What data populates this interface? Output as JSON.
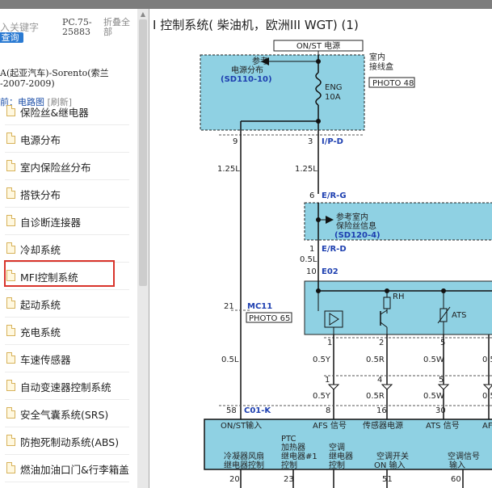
{
  "sidebar": {
    "search_hint": "入关键字",
    "search_button": "查询",
    "pc_code_line1": "PC.75-",
    "pc_code_line2": "25883",
    "collapse_line1": "折叠全",
    "collapse_line2": "部",
    "vehicle_line1": "A(起亚汽车)-Sorento(索兰",
    "vehicle_line2": "-2007-2009)",
    "crumb_current": "前：电路图",
    "crumb_refresh": "[刷新]",
    "items": [
      {
        "label": "保险丝&继电器"
      },
      {
        "label": "电源分布"
      },
      {
        "label": "室内保险丝分布"
      },
      {
        "label": "搭铁分布"
      },
      {
        "label": "自诊断连接器"
      },
      {
        "label": "冷却系统"
      },
      {
        "label": "MFI控制系统",
        "selected": true
      },
      {
        "label": "起动系统"
      },
      {
        "label": "充电系统"
      },
      {
        "label": "车速传感器"
      },
      {
        "label": "自动变速器控制系统"
      },
      {
        "label": "安全气囊系统(SRS)"
      },
      {
        "label": "防抱死制动系统(ABS)"
      },
      {
        "label": "燃油加油口门&行李箱盖"
      }
    ]
  },
  "diagram": {
    "title": "I 控制系统( 柴油机，欧洲III WGT) (1)",
    "on_st_power": "ON/ST 电源",
    "junction_box_line1": "室内",
    "junction_box_line2": "接线盒",
    "photo_48": "PHOTO 48",
    "ref_power_line1": "参考",
    "ref_power_line2": "电源分布",
    "ref_power_code": "(SD110-10)",
    "fuse_name": "ENG",
    "fuse_rating": "10A",
    "pin_9": "9",
    "pin_3": "3",
    "conn_ip_d": "I/P-D",
    "wire_125l_a": "1.25L",
    "wire_125l_b": "1.25L",
    "pin_6": "6",
    "conn_er_g": "E/R-G",
    "ref_fuse_line1": "参考室内",
    "ref_fuse_line2": "保险丝信息",
    "ref_fuse_code": "(SD120-4)",
    "pin_1_erd": "1",
    "conn_er_d": "E/R-D",
    "wire_05l_a": "0.5L",
    "pin_10": "10",
    "conn_e02": "E02",
    "pin_21": "21",
    "conn_mc11": "MC11",
    "photo_65": "PHOTO 65",
    "rh": "RH",
    "ats": "ATS",
    "pin_1_r": "1",
    "pin_2_r": "2",
    "pin_5_r": "5",
    "wire_05y_a": "0.5Y",
    "wire_05r_a": "0.5R",
    "wire_05w_a": "0.5W",
    "wire_05_a": "0.5",
    "wire_05l_b": "0.5L",
    "pin_1_c": "1",
    "pin_4_c": "4",
    "pin_5_c": "5",
    "wire_05y_b": "0.5Y",
    "wire_05r_b": "0.5R",
    "wire_05w_b": "0.5W",
    "wire_05_b": "0.5",
    "pin_58": "58",
    "conn_c01k": "C01-K",
    "pin_8": "8",
    "pin_16": "16",
    "pin_30": "30",
    "ecu_on_st": "ON/ST输入",
    "ecu_afs": "AFS 信号",
    "ecu_sensor_power": "传感器电源",
    "ecu_ats": "ATS 信号",
    "ecu_af": "AF",
    "ecu_fan_relay_line1": "冷凝器风扇",
    "ecu_fan_relay_line2": "继电器控制",
    "ecu_ptc_line1": "PTC",
    "ecu_ptc_line2": "加热器",
    "ecu_ptc_line3": "继电器#1",
    "ecu_ptc_line4": "控制",
    "ecu_ac_relay_line1": "空调",
    "ecu_ac_relay_line2": "继电器",
    "ecu_ac_relay_line3": "控制",
    "ecu_ac_switch_line1": "空调开关",
    "ecu_ac_switch_line2": "ON 输入",
    "ecu_ac_signal_line1": "空调信号",
    "ecu_ac_signal_line2": "输入",
    "pin_20": "20",
    "pin_23": "23",
    "pin_51": "51",
    "pin_60": "60"
  }
}
